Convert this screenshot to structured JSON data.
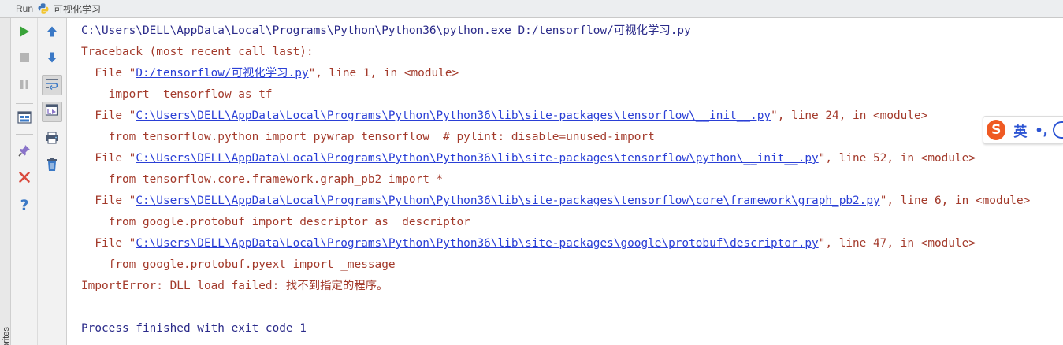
{
  "header": {
    "run_label": "Run",
    "config_name": "可视化学习"
  },
  "favorites": {
    "label": "orites"
  },
  "toolbar": {
    "run_icon": "run-icon",
    "stop_icon": "stop-icon",
    "pause_icon": "pause-icon",
    "layout_icon": "restore-layout-icon",
    "pin_icon": "pin-icon",
    "close_icon": "close-icon",
    "help_label": "?",
    "up_icon": "up-arrow-icon",
    "down_icon": "down-arrow-icon",
    "softwrap_icon": "soft-wrap-icon",
    "scroll_icon": "scroll-to-end-icon",
    "print_icon": "print-icon",
    "clear_icon": "trash-icon"
  },
  "colors": {
    "error_text": "#a33a2b",
    "normal_text": "#2b2b8a",
    "link": "#2a3fd6",
    "run_green": "#3aa33a",
    "close_red": "#d94a3d",
    "accent_blue": "#3b79c6",
    "ime_orange": "#ef5a23"
  },
  "console": {
    "command": "C:\\Users\\DELL\\AppData\\Local\\Programs\\Python\\Python36\\python.exe D:/tensorflow/可视化学习.py",
    "traceback_header": "Traceback (most recent call last):",
    "frames": [
      {
        "prefix": "  File \"",
        "path": "D:/tensorflow/可视化学习.py",
        "suffix": "\", line 1, in <module>",
        "code": "    import  tensorflow as tf"
      },
      {
        "prefix": "  File \"",
        "path": "C:\\Users\\DELL\\AppData\\Local\\Programs\\Python\\Python36\\lib\\site-packages\\tensorflow\\__init__.py",
        "suffix": "\", line 24, in <module>",
        "code": "    from tensorflow.python import pywrap_tensorflow  # pylint: disable=unused-import"
      },
      {
        "prefix": "  File \"",
        "path": "C:\\Users\\DELL\\AppData\\Local\\Programs\\Python\\Python36\\lib\\site-packages\\tensorflow\\python\\__init__.py",
        "suffix": "\", line 52, in <module>",
        "code": "    from tensorflow.core.framework.graph_pb2 import *"
      },
      {
        "prefix": "  File \"",
        "path": "C:\\Users\\DELL\\AppData\\Local\\Programs\\Python\\Python36\\lib\\site-packages\\tensorflow\\core\\framework\\graph_pb2.py",
        "suffix": "\", line 6, in <module>",
        "code": "    from google.protobuf import descriptor as _descriptor"
      },
      {
        "prefix": "  File \"",
        "path": "C:\\Users\\DELL\\AppData\\Local\\Programs\\Python\\Python36\\lib\\site-packages\\google\\protobuf\\descriptor.py",
        "suffix": "\", line 47, in <module>",
        "code": "    from google.protobuf.pyext import _message"
      }
    ],
    "error": "ImportError: DLL load failed: 找不到指定的程序。",
    "exit": "Process finished with exit code 1"
  },
  "ime": {
    "logo": "S",
    "lang": "英",
    "punct": "•,"
  }
}
